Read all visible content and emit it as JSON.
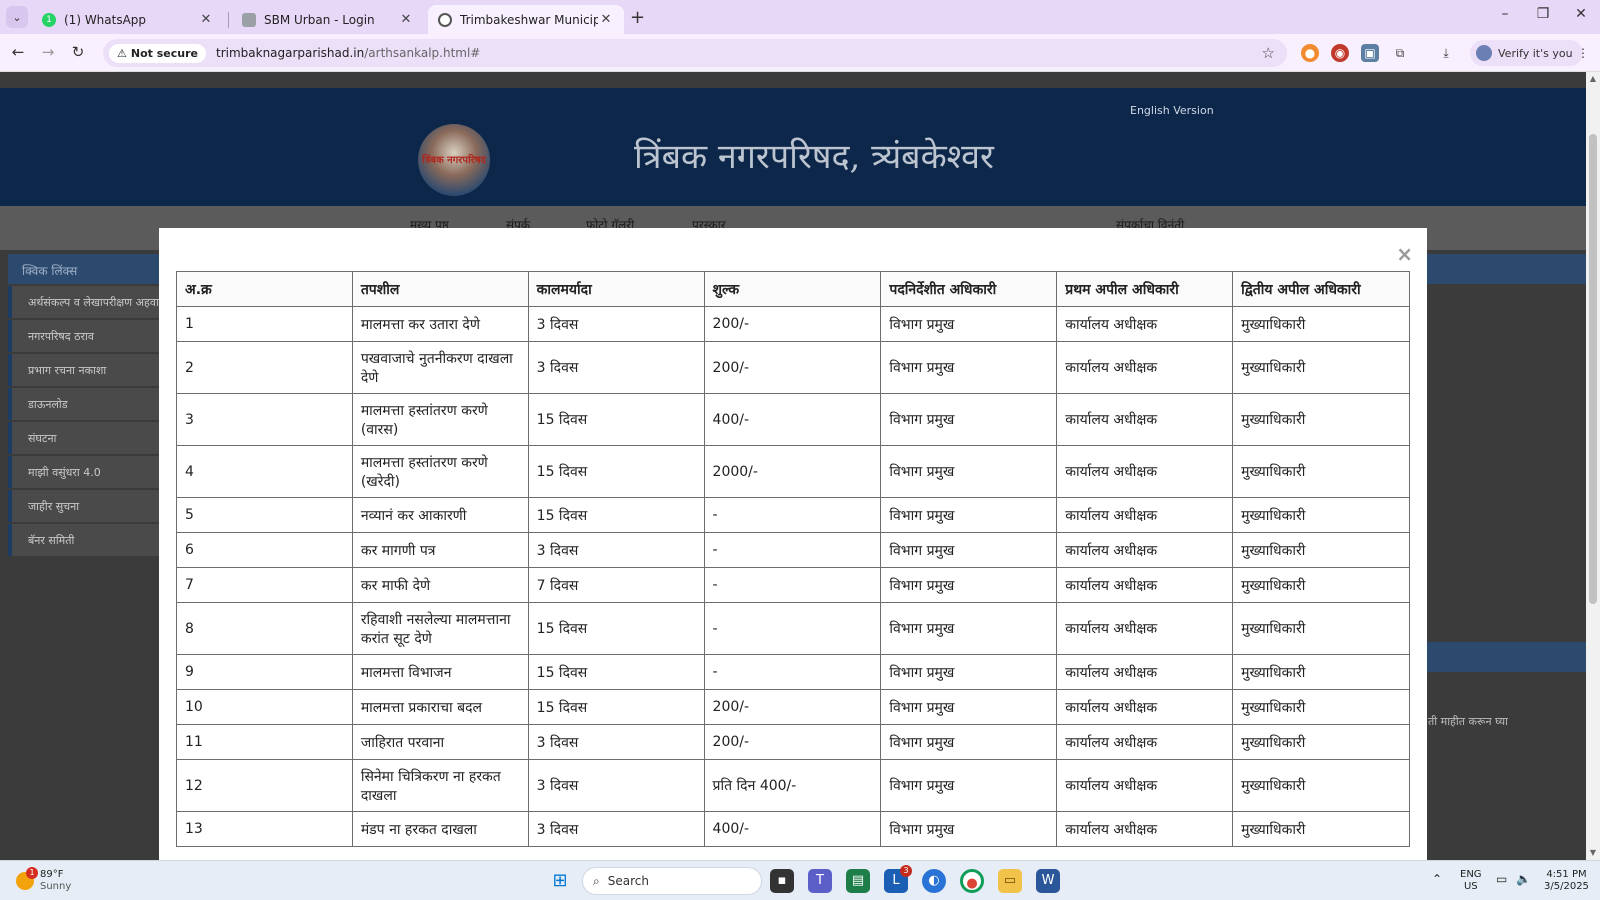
{
  "browser": {
    "tabs": [
      {
        "title": "(1) WhatsApp",
        "active": false
      },
      {
        "title": "SBM Urban - Login",
        "active": false
      },
      {
        "title": "Trimbakeshwar Municipal Coun",
        "active": true
      }
    ],
    "new_tab": "+",
    "security_label": "Not secure",
    "url_host": "trimbaknagarparishad.in",
    "url_path": "/arthsankalp.html#",
    "verify_label": "Verify it's you",
    "window_controls": [
      "–",
      "❐",
      "✕"
    ]
  },
  "site": {
    "english_link": "English Version",
    "logo_text": "त्रिंबक नगरपरिषद",
    "title": "त्रिंबक नगरपरिषद, त्र्यंबकेश्वर",
    "nav": [
      "मुख्य पृष्ठ",
      "संपर्क",
      "फोटो गॅलरी",
      "पुरस्कार",
      "संपर्काचा विनंती"
    ],
    "sidebar_title": "क्विक लिंक्स",
    "sidebar_items": [
      "अर्थसंकल्प व लेखापरीक्षण अहवाल",
      "नगरपरिषद ठराव",
      "प्रभाग रचना नकाशा",
      "डाऊनलोड",
      "संघटना",
      "माझी वसुंधरा 4.0",
      "जाहीर सुचना",
      "बॅनर समिती"
    ],
    "right_text": "ती माहीत करून घ्या"
  },
  "modal": {
    "close": "×",
    "headers": [
      "अ.क्र",
      "तपशील",
      "कालमर्यादा",
      "शुल्क",
      "पदनिर्देशीत अधिकारी",
      "प्रथम अपील अधिकारी",
      "द्वितीय अपील अधिकारी"
    ],
    "rows": [
      {
        "no": "1",
        "detail": "मालमत्ता कर उतारा देणे",
        "time": "3 दिवस",
        "fee": "200/-",
        "officer": "विभाग प्रमुख",
        "first": "कार्यालय अधीक्षक",
        "second": "मुख्याधिकारी",
        "tall": false
      },
      {
        "no": "2",
        "detail": "पखवाजाचे नुतनीकरण दाखला देणे",
        "time": "3 दिवस",
        "fee": "200/-",
        "officer": "विभाग प्रमुख",
        "first": "कार्यालय अधीक्षक",
        "second": "मुख्याधिकारी",
        "tall": true
      },
      {
        "no": "3",
        "detail": "मालमत्ता हस्तांतरण करणे (वारस)",
        "time": "15 दिवस",
        "fee": "400/-",
        "officer": "विभाग प्रमुख",
        "first": "कार्यालय अधीक्षक",
        "second": "मुख्याधिकारी",
        "tall": true
      },
      {
        "no": "4",
        "detail": "मालमत्ता हस्तांतरण करणे (खरेदी)",
        "time": "15 दिवस",
        "fee": "2000/-",
        "officer": "विभाग प्रमुख",
        "first": "कार्यालय अधीक्षक",
        "second": "मुख्याधिकारी",
        "tall": true
      },
      {
        "no": "5",
        "detail": "नव्यानं कर आकारणी",
        "time": "15 दिवस",
        "fee": "-",
        "officer": "विभाग प्रमुख",
        "first": "कार्यालय अधीक्षक",
        "second": "मुख्याधिकारी",
        "tall": false
      },
      {
        "no": "6",
        "detail": "कर मागणी पत्र",
        "time": "3 दिवस",
        "fee": "-",
        "officer": "विभाग प्रमुख",
        "first": "कार्यालय अधीक्षक",
        "second": "मुख्याधिकारी",
        "tall": false
      },
      {
        "no": "7",
        "detail": "कर माफी देणे",
        "time": "7 दिवस",
        "fee": "-",
        "officer": "विभाग प्रमुख",
        "first": "कार्यालय अधीक्षक",
        "second": "मुख्याधिकारी",
        "tall": false
      },
      {
        "no": "8",
        "detail": "रहिवाशी नसलेल्या मालमत्ताना करांत सूट देणे",
        "time": "15 दिवस",
        "fee": "-",
        "officer": "विभाग प्रमुख",
        "first": "कार्यालय अधीक्षक",
        "second": "मुख्याधिकारी",
        "tall": true
      },
      {
        "no": "9",
        "detail": "मालमत्ता विभाजन",
        "time": "15 दिवस",
        "fee": "-",
        "officer": "विभाग प्रमुख",
        "first": "कार्यालय अधीक्षक",
        "second": "मुख्याधिकारी",
        "tall": false
      },
      {
        "no": "10",
        "detail": "मालमत्ता प्रकाराचा बदल",
        "time": "15 दिवस",
        "fee": "200/-",
        "officer": "विभाग प्रमुख",
        "first": "कार्यालय अधीक्षक",
        "second": "मुख्याधिकारी",
        "tall": false
      },
      {
        "no": "11",
        "detail": "जाहिरात परवाना",
        "time": "3 दिवस",
        "fee": "200/-",
        "officer": "विभाग प्रमुख",
        "first": "कार्यालय अधीक्षक",
        "second": "मुख्याधिकारी",
        "tall": false
      },
      {
        "no": "12",
        "detail": "सिनेमा चित्रिकरण ना हरकत दाखला",
        "time": "3 दिवस",
        "fee": "प्रति दिन 400/-",
        "officer": "विभाग प्रमुख",
        "first": "कार्यालय अधीक्षक",
        "second": "मुख्याधिकारी",
        "tall": true
      },
      {
        "no": "13",
        "detail": "मंडप ना हरकत दाखला",
        "time": "3 दिवस",
        "fee": "400/-",
        "officer": "विभाग प्रमुख",
        "first": "कार्यालय अधीक्षक",
        "second": "मुख्याधिकारी",
        "tall": false
      }
    ]
  },
  "taskbar": {
    "weather_badge": "1",
    "temperature": "89°F",
    "condition": "Sunny",
    "search_placeholder": "Search",
    "teams_badge": "3",
    "lang": "ENG",
    "region": "US",
    "time": "4:51 PM",
    "date": "3/5/2025"
  }
}
